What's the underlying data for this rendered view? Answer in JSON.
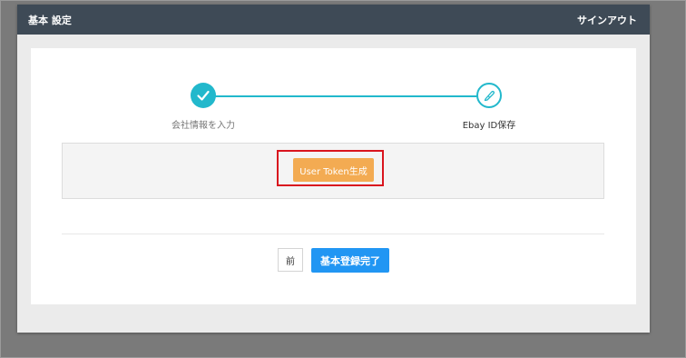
{
  "header": {
    "title": "基本 設定",
    "signout_label": "サインアウト"
  },
  "steps": [
    {
      "label": "会社情報を入力",
      "status": "complete",
      "icon": "check-icon"
    },
    {
      "label": "Ebay ID保存",
      "status": "active",
      "icon": "pen-icon"
    }
  ],
  "token_panel": {
    "button_label": "User Token生成"
  },
  "footer": {
    "prev_label": "前",
    "complete_label": "基本登録完了"
  },
  "colors": {
    "header_bg": "#3e4a56",
    "step_accent": "#22b8cc",
    "token_button": "#f3ab52",
    "primary_button": "#2196f3",
    "highlight": "#d9151e"
  }
}
